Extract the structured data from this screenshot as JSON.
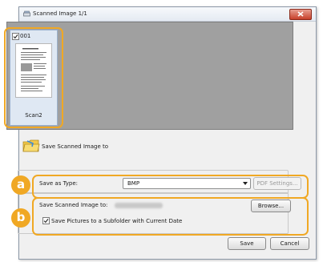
{
  "window": {
    "title": "Scanned Image 1/1"
  },
  "thumbnail": {
    "number": "001",
    "checked": true,
    "label": "Scan2"
  },
  "save_section": {
    "heading": "Save Scanned Image to"
  },
  "callouts": {
    "a": "a",
    "b": "b"
  },
  "save_as_type": {
    "label": "Save as Type:",
    "value": "BMP",
    "pdf_settings_label": "PDF Settings..."
  },
  "save_location": {
    "label": "Save Scanned Image to:",
    "browse_label": "Browse..."
  },
  "subfolder_option": {
    "label": "Save Pictures to a Subfolder with Current Date",
    "checked": true
  },
  "footer": {
    "save_label": "Save",
    "cancel_label": "Cancel"
  },
  "colors": {
    "highlight": "#f0a824",
    "preview_background": "#a0a0a0"
  }
}
